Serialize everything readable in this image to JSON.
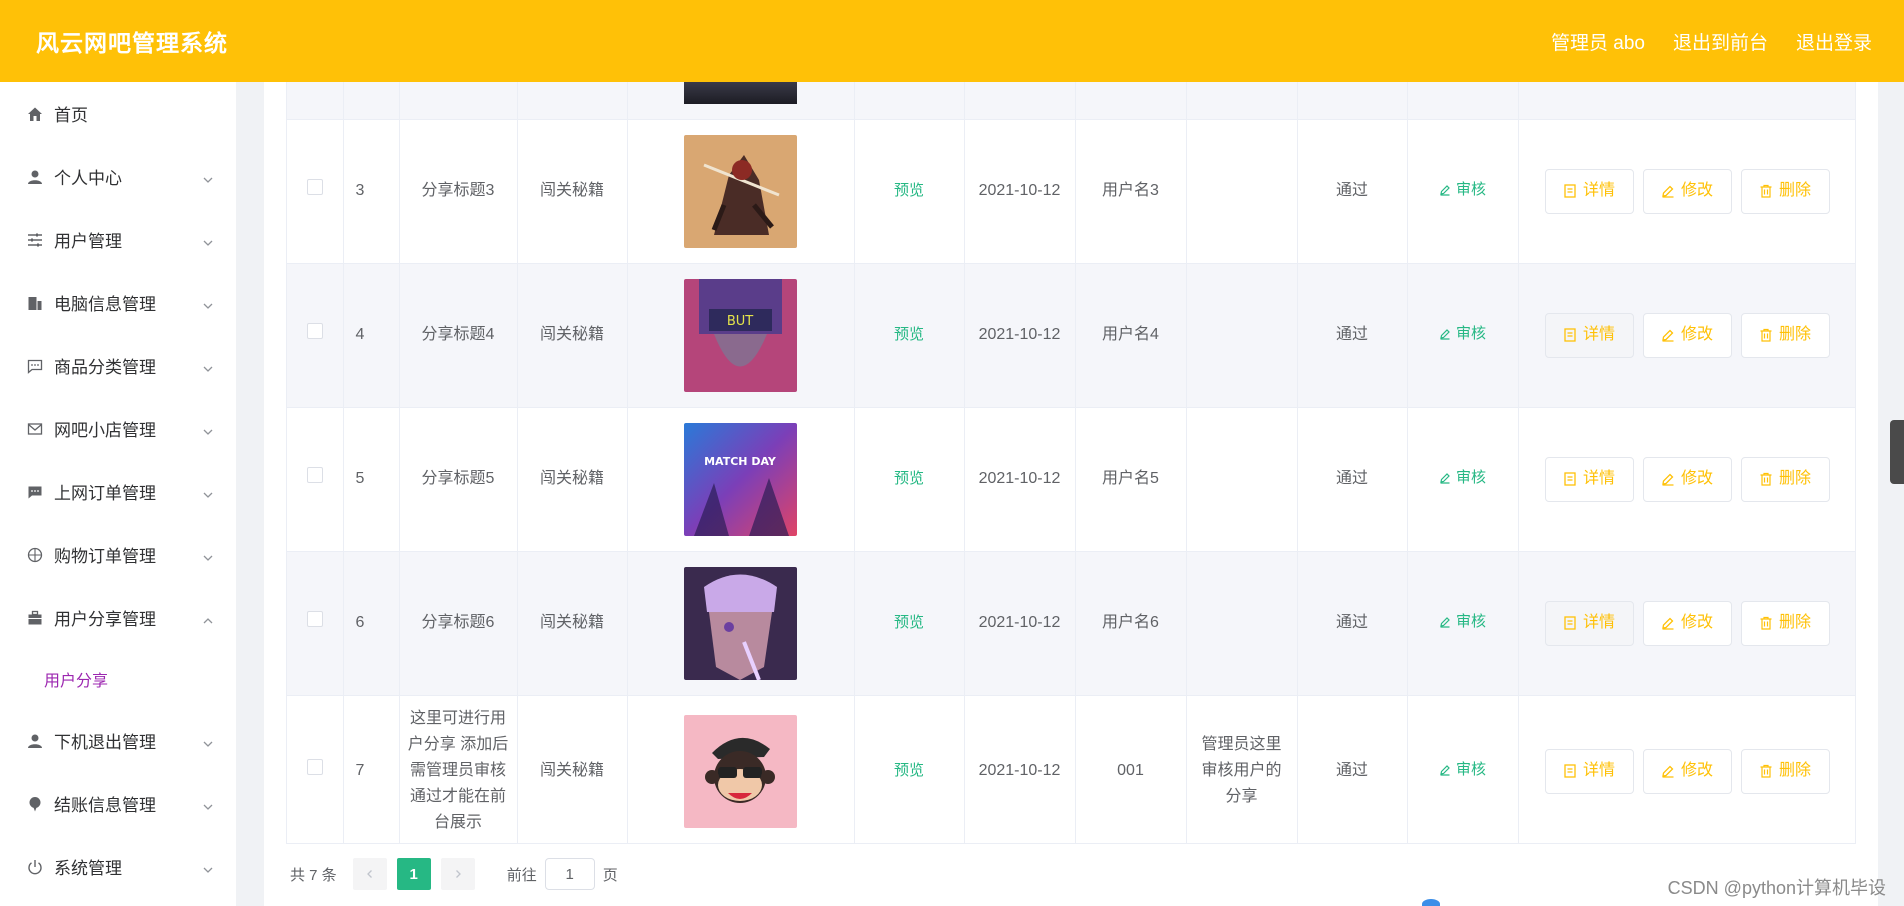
{
  "header": {
    "title": "风云网吧管理系统",
    "admin": "管理员 abo",
    "to_front": "退出到前台",
    "logout": "退出登录"
  },
  "sidebar": {
    "items": [
      {
        "label": "首页",
        "icon": "home-icon"
      },
      {
        "label": "个人中心",
        "icon": "user-icon"
      },
      {
        "label": "用户管理",
        "icon": "sliders-icon"
      },
      {
        "label": "电脑信息管理",
        "icon": "building-icon"
      },
      {
        "label": "商品分类管理",
        "icon": "chat-dots-icon"
      },
      {
        "label": "网吧小店管理",
        "icon": "mail-icon"
      },
      {
        "label": "上网订单管理",
        "icon": "chat-filled-icon"
      },
      {
        "label": "购物订单管理",
        "icon": "globe-icon"
      },
      {
        "label": "用户分享管理",
        "icon": "briefcase-icon"
      },
      {
        "label": "下机退出管理",
        "icon": "user-icon"
      },
      {
        "label": "结账信息管理",
        "icon": "pin-icon"
      },
      {
        "label": "系统管理",
        "icon": "power-icon"
      }
    ],
    "sub_item": "用户分享"
  },
  "table": {
    "preview_label": "预览",
    "audit_label": "审核",
    "detail_label": "详情",
    "edit_label": "修改",
    "delete_label": "删除",
    "rows": [
      {
        "no": "3",
        "title": "分享标题3",
        "category": "闯关秘籍",
        "date": "2021-10-12",
        "user": "用户名3",
        "reply": "",
        "status": "通过",
        "img": "img-warrior"
      },
      {
        "no": "4",
        "title": "分享标题4",
        "category": "闯关秘籍",
        "date": "2021-10-12",
        "user": "用户名4",
        "reply": "",
        "status": "通过",
        "img": "img-cyber"
      },
      {
        "no": "5",
        "title": "分享标题5",
        "category": "闯关秘籍",
        "date": "2021-10-12",
        "user": "用户名5",
        "reply": "",
        "status": "通过",
        "img": "img-matchday"
      },
      {
        "no": "6",
        "title": "分享标题6",
        "category": "闯关秘籍",
        "date": "2021-10-12",
        "user": "用户名6",
        "reply": "",
        "status": "通过",
        "img": "img-ninja"
      },
      {
        "no": "7",
        "title": "这里可进行用户分享 添加后需管理员审核通过才能在前台展示",
        "category": "闯关秘籍",
        "date": "2021-10-12",
        "user": "001",
        "reply": "管理员这里审核用户的分享",
        "status": "通过",
        "img": "img-monkey"
      }
    ],
    "thumb_text": {
      "cyber": "BUT",
      "matchday": "MATCH DAY"
    }
  },
  "pager": {
    "total": "共 7 条",
    "current": "1",
    "goto_prefix": "前往",
    "goto_value": "1",
    "goto_suffix": "页"
  },
  "watermark": "CSDN @python计算机毕设",
  "colors": {
    "header": "#ffc107",
    "accent_green": "#26b884",
    "action_yellow": "#ffc107",
    "submenu_purple": "#9c27b0"
  }
}
